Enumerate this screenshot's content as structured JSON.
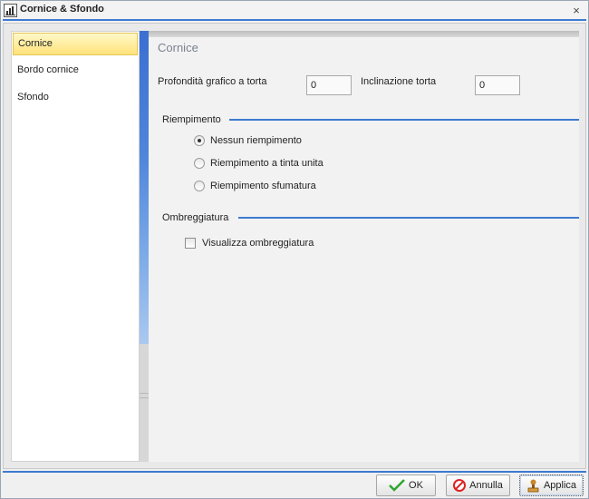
{
  "window": {
    "title": "Cornice & Sfondo",
    "close_glyph": "×"
  },
  "nav": {
    "items": [
      {
        "label": "Cornice",
        "selected": true
      },
      {
        "label": "Bordo cornice",
        "selected": false
      },
      {
        "label": "Sfondo",
        "selected": false
      }
    ]
  },
  "panel": {
    "title": "Cornice",
    "depth_label": "Profondità grafico a torta",
    "depth_value": "0",
    "tilt_label": "Inclinazione torta",
    "tilt_value": "0",
    "fill_section": "Riempimento",
    "fill_options": [
      {
        "label": "Nessun riempimento",
        "checked": true
      },
      {
        "label": "Riempimento a tinta unita",
        "checked": false
      },
      {
        "label": "Riempimento sfumatura",
        "checked": false
      }
    ],
    "shadow_section": "Ombreggiatura",
    "shadow_checkbox": {
      "label": "Visualizza ombreggiatura",
      "checked": false
    }
  },
  "buttons": {
    "ok": "OK",
    "cancel": "Annulla",
    "apply": "Applica"
  },
  "colors": {
    "accent": "#3d7bd0",
    "selection": "#ffe27a"
  },
  "icons": {
    "app": "chart-window-icon",
    "ok": "checkmark-icon",
    "cancel": "no-entry-icon",
    "apply": "stamp-icon"
  }
}
